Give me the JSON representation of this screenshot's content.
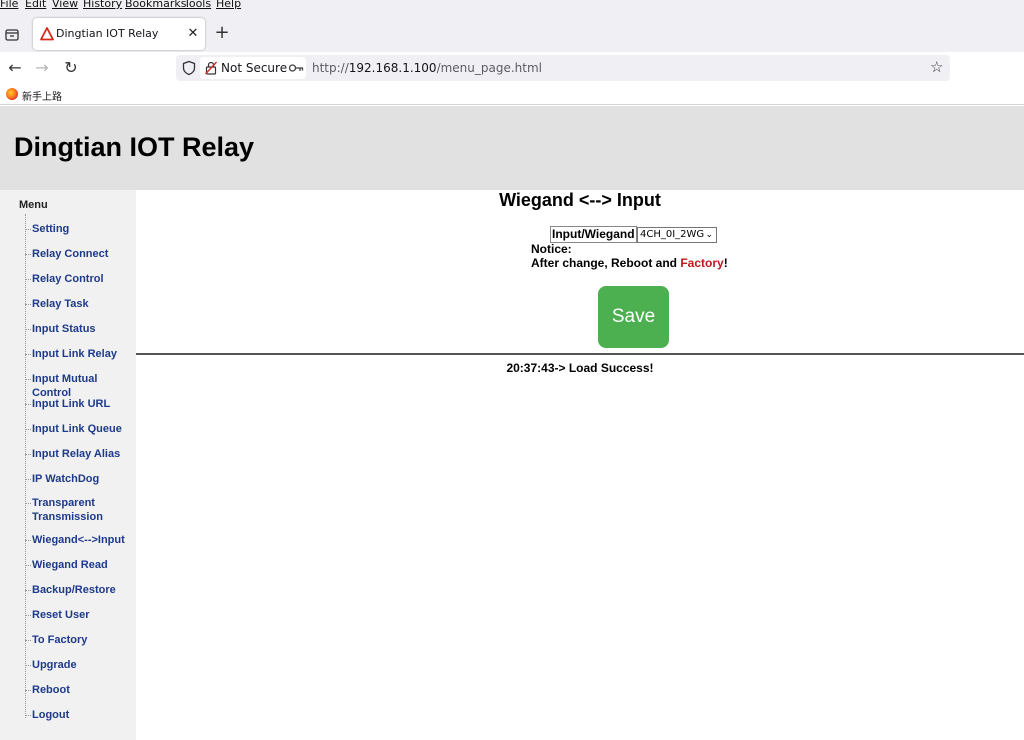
{
  "browser": {
    "menu": [
      "File",
      "Edit",
      "View",
      "History",
      "Bookmarks",
      "Tools",
      "Help"
    ],
    "tab_title": "Dingtian IOT Relay",
    "new_tab_symbol": "+",
    "not_secure_label": "Not Secure",
    "url_scheme": "http://",
    "url_host": "192.168.1.100",
    "url_path": "/menu_page.html",
    "bookmark_label": "新手上路"
  },
  "header": {
    "title": "Dingtian IOT Relay"
  },
  "sidebar": {
    "title": "Menu",
    "items": [
      "Setting",
      "Relay Connect",
      "Relay Control",
      "Relay Task",
      "Input Status",
      "Input Link Relay",
      "Input Mutual Control",
      "Input Link URL",
      "Input Link Queue",
      "Input Relay Alias",
      "IP WatchDog",
      "Transparent Transmission",
      "Wiegand<-->Input",
      "Wiegand Read",
      "Backup/Restore",
      "Reset User",
      "To Factory",
      "Upgrade",
      "Reboot",
      "Logout"
    ]
  },
  "main": {
    "title": "Wiegand <--> Input",
    "form_label": "Input/Wiegand",
    "select_value": "4CH_0I_2WG",
    "notice_line1": "Notice:",
    "notice_prefix": "After change, Reboot and ",
    "notice_highlight": "Factory",
    "notice_suffix": "!",
    "save_label": "Save",
    "status": "20:37:43-> Load Success!"
  },
  "colors": {
    "accent_green": "#4caf50",
    "menu_link": "#1e3a8a",
    "notice_red": "#c0171c",
    "header_bg": "#e1e1e1"
  },
  "icons": [
    "tab-list-icon",
    "warning-favicon-icon",
    "close-icon",
    "back-icon",
    "forward-icon",
    "reload-icon",
    "shield-icon",
    "lock-icon",
    "key-icon",
    "star-icon",
    "firefox-icon"
  ]
}
